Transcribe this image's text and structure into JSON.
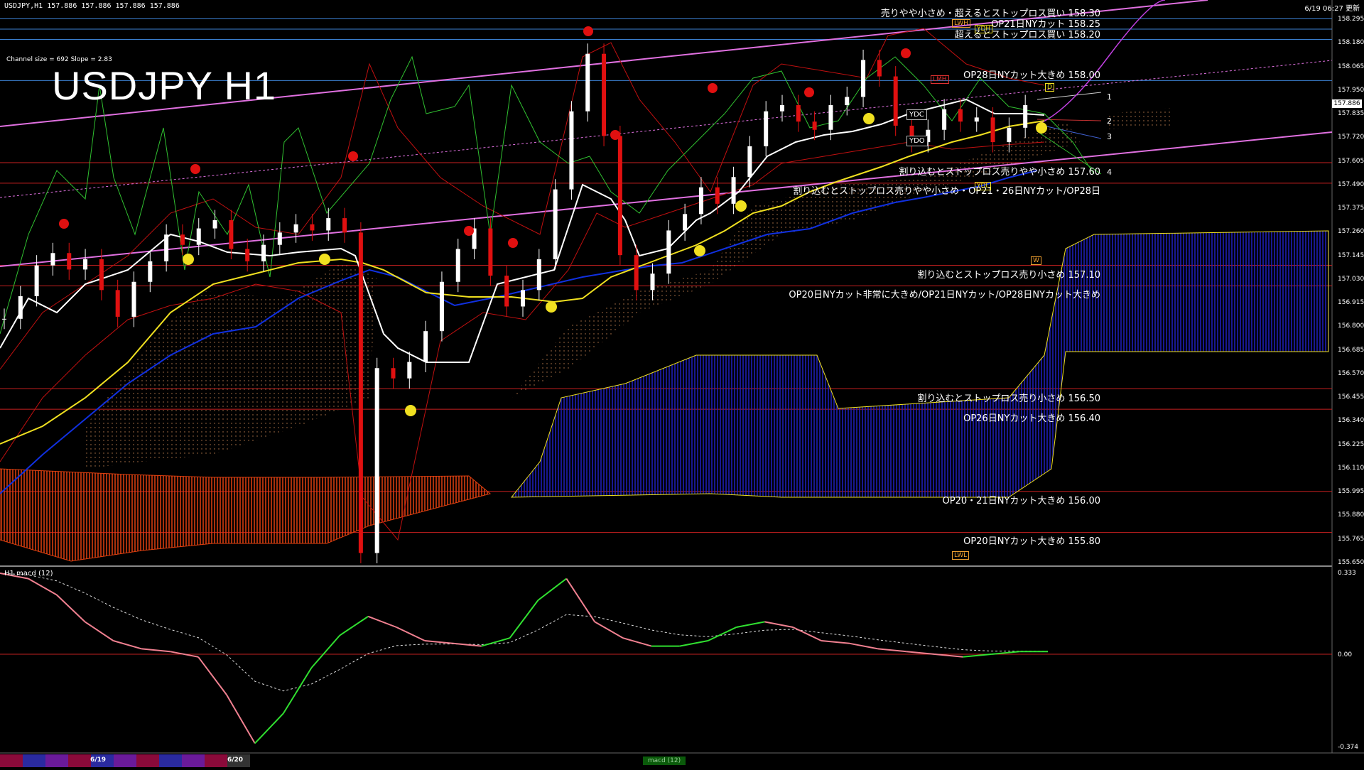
{
  "header": {
    "instrument": "USDJPY,H1  157.886 157.886 157.886 157.886",
    "timestamp": "6/19 06:27 更新",
    "channel_info": "Channel size = 692 Slope = 2.83",
    "symbol_title": "USDJPY H1"
  },
  "price_axis": [
    "158.295",
    "158.180",
    "158.065",
    "157.950",
    "157.835",
    "157.720",
    "157.605",
    "157.490",
    "157.375",
    "157.260",
    "157.145",
    "157.030",
    "156.915",
    "156.800",
    "156.685",
    "156.570",
    "156.455",
    "156.340",
    "156.225",
    "156.110",
    "155.995",
    "155.880",
    "155.765",
    "155.650"
  ],
  "current_price": "157.886",
  "levels": [
    {
      "label": "売りやや小さめ・超えるとストップロス買い 158.30",
      "price": 158.3,
      "color": "#3b7fd0"
    },
    {
      "label": "OP21日NYカット 158.25",
      "price": 158.25,
      "color": "#3b7fd0"
    },
    {
      "label": "超えるとストップロス買い 158.20",
      "price": 158.2,
      "color": "#3b7fd0"
    },
    {
      "label": "OP28日NYカット大きめ 158.00",
      "price": 158.0,
      "color": "#3b7fd0"
    },
    {
      "label": "割り込むとストップロス売りやや小さめ 157.60",
      "price": 157.6,
      "color": "#c82020"
    },
    {
      "label": "割り込むとストップロス売りやや小さめ・OP21・26日NYカット/OP28日",
      "price": 157.5,
      "color": "#c82020"
    },
    {
      "label": "割り込むとストップロス売り小さめ 157.10",
      "price": 157.1,
      "color": "#c82020"
    },
    {
      "label": "OP20日NYカット非常に大きめ/OP21日NYカット/OP28日NYカット大きめ",
      "price": 157.0,
      "color": "#c82020"
    },
    {
      "label": "割り込むとストップロス売り小さめ 156.50",
      "price": 156.5,
      "color": "#c82020"
    },
    {
      "label": "OP26日NYカット大きめ 156.40",
      "price": 156.4,
      "color": "#c82020"
    },
    {
      "label": "OP20・21日NYカット大きめ 156.00",
      "price": 156.0,
      "color": "#c82020"
    },
    {
      "label": "OP20日NYカット大きめ 155.80",
      "price": 155.8,
      "color": "#c82020"
    }
  ],
  "tags": {
    "ydc": "YDC",
    "ydo": "YDO",
    "ydh": "YDH",
    "ydl": "YDL",
    "lwh": "LWH",
    "lwl": "LWL",
    "lmh": "LMH",
    "w": "W",
    "d": "D"
  },
  "channel_labels": [
    "1",
    "2",
    "3",
    "4"
  ],
  "macd": {
    "title": "H1  macd (12)",
    "axis_top": "0.333",
    "axis_mid": "0.00",
    "axis_bottom": "-0.374",
    "tab": "macd (12)"
  },
  "bottom_dates": [
    "6/19",
    "6/20"
  ],
  "colors": {
    "bull": "#ffffff",
    "bear": "#e01010",
    "tenkan": "#ffffff",
    "kijun": "#f0e020",
    "ma_blue": "#1030e0",
    "channel": "#e070e0",
    "bb": "#c01010",
    "chikou": "#30c030",
    "cloud_bull": "#2020c0",
    "cloud_bear": "#e04010",
    "macd_up": "#30e030",
    "macd_down": "#f08090"
  },
  "chart_data": {
    "type": "line",
    "title": "USDJPY H1",
    "ylim": [
      155.65,
      158.33
    ],
    "candles_close_approx": [
      156.84,
      156.95,
      157.1,
      157.16,
      157.08,
      157.13,
      156.98,
      156.85,
      157.02,
      157.12,
      157.25,
      157.2,
      157.28,
      157.32,
      157.18,
      157.12,
      157.2,
      157.26,
      157.3,
      157.27,
      157.33,
      157.26,
      155.7,
      156.6,
      156.55,
      156.63,
      156.78,
      157.02,
      157.18,
      157.28,
      157.05,
      156.9,
      156.98,
      157.13,
      157.47,
      157.85,
      158.13,
      157.73,
      157.15,
      156.98,
      157.06,
      157.27,
      157.35,
      157.48,
      157.4,
      157.53,
      157.68,
      157.85,
      157.88,
      157.8,
      157.76,
      157.88,
      157.92,
      158.1,
      158.02,
      157.78,
      157.7,
      157.76,
      157.86,
      157.8,
      157.82,
      157.7,
      157.77,
      157.88
    ],
    "macd_series": [
      0.3,
      0.28,
      0.22,
      0.12,
      0.05,
      0.02,
      0.01,
      -0.01,
      -0.15,
      -0.33,
      -0.22,
      -0.05,
      0.07,
      0.14,
      0.1,
      0.05,
      0.04,
      0.03,
      0.06,
      0.2,
      0.28,
      0.12,
      0.06,
      0.03,
      0.03,
      0.05,
      0.1,
      0.12,
      0.1,
      0.05,
      0.04,
      0.02,
      0.01,
      0.0,
      -0.01,
      0.0,
      0.01,
      0.01
    ]
  }
}
